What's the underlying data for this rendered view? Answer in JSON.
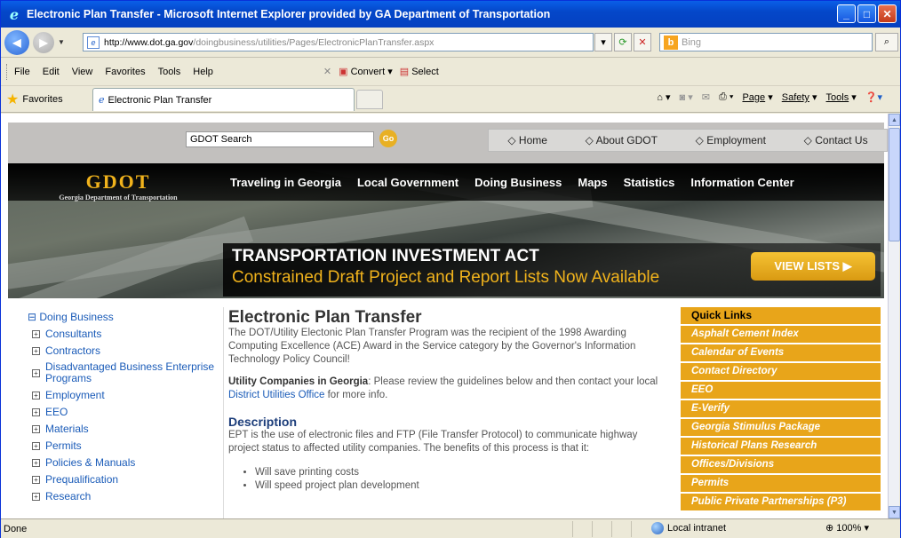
{
  "window": {
    "title": "Electronic Plan Transfer - Microsoft Internet Explorer provided by GA Department of Transportation"
  },
  "address": {
    "domain": "http://www.dot.ga.gov",
    "path": "/doingbusiness/utilities/Pages/ElectronicPlanTransfer.aspx",
    "search_placeholder": "Bing"
  },
  "menu": [
    "File",
    "Edit",
    "View",
    "Favorites",
    "Tools",
    "Help"
  ],
  "toolbar": {
    "convert": "Convert",
    "select": "Select"
  },
  "favbar": {
    "favorites": "Favorites",
    "tab_title": "Electronic Plan Transfer"
  },
  "commandbar": {
    "page": "Page",
    "safety": "Safety",
    "tools": "Tools"
  },
  "site": {
    "search_value": "GDOT Search",
    "go": "Go",
    "topnav": [
      "◇ Home",
      "◇ About GDOT",
      "◇ Employment",
      "◇ Contact Us"
    ],
    "logo": "GDOT",
    "logo_sub": "Georgia Department of Transportation",
    "mainnav": [
      "Traveling in Georgia",
      "Local Government",
      "Doing Business",
      "Maps",
      "Statistics",
      "Information Center"
    ],
    "promo_line1": "TRANSPORTATION INVESTMENT ACT",
    "promo_line2": "Constrained Draft Project and Report Lists Now Available",
    "promo_button": "VIEW LISTS ▶"
  },
  "leftnav": {
    "root": "Doing Business",
    "items": [
      "Consultants",
      "Contractors",
      "Disadvantaged Business Enterprise Programs",
      "Employment",
      "EEO",
      "Materials",
      "Permits",
      "Policies & Manuals",
      "Prequalification",
      "Research"
    ]
  },
  "main": {
    "title": "Electronic Plan Transfer",
    "intro": "The DOT/Utility Electonic Plan Transfer Program was the recipient of the 1998 Awarding Computing Excellence (ACE) Award in the Service category by the Governor's Information Technology Policy Council!",
    "utility_bold": "Utility Companies in Georgia",
    "utility_text": ": Please review the guidelines below and then contact your local ",
    "utility_link": "District Utilities Office",
    "utility_end": " for more info.",
    "desc_heading": "Description",
    "desc_text": "EPT is the use of electronic files and FTP (File Transfer Protocol) to communicate highway project status to affected utility companies. The benefits of this process is that it:",
    "bullets": [
      "Will save printing costs",
      "Will speed project plan development"
    ]
  },
  "quicklinks": {
    "header": "Quick Links",
    "items": [
      "Asphalt Cement Index",
      "Calendar of Events",
      "Contact Directory",
      "EEO",
      "E-Verify",
      "Georgia Stimulus Package",
      "Historical Plans Research",
      "Offices/Divisions",
      "Permits",
      "Public Private Partnerships (P3)"
    ]
  },
  "status": {
    "left": "Done",
    "zone": "Local intranet",
    "zoom": "100%"
  },
  "colors": {
    "accent": "#e8a51a",
    "link": "#1a5bb8",
    "titlebar": "#0447c9"
  }
}
